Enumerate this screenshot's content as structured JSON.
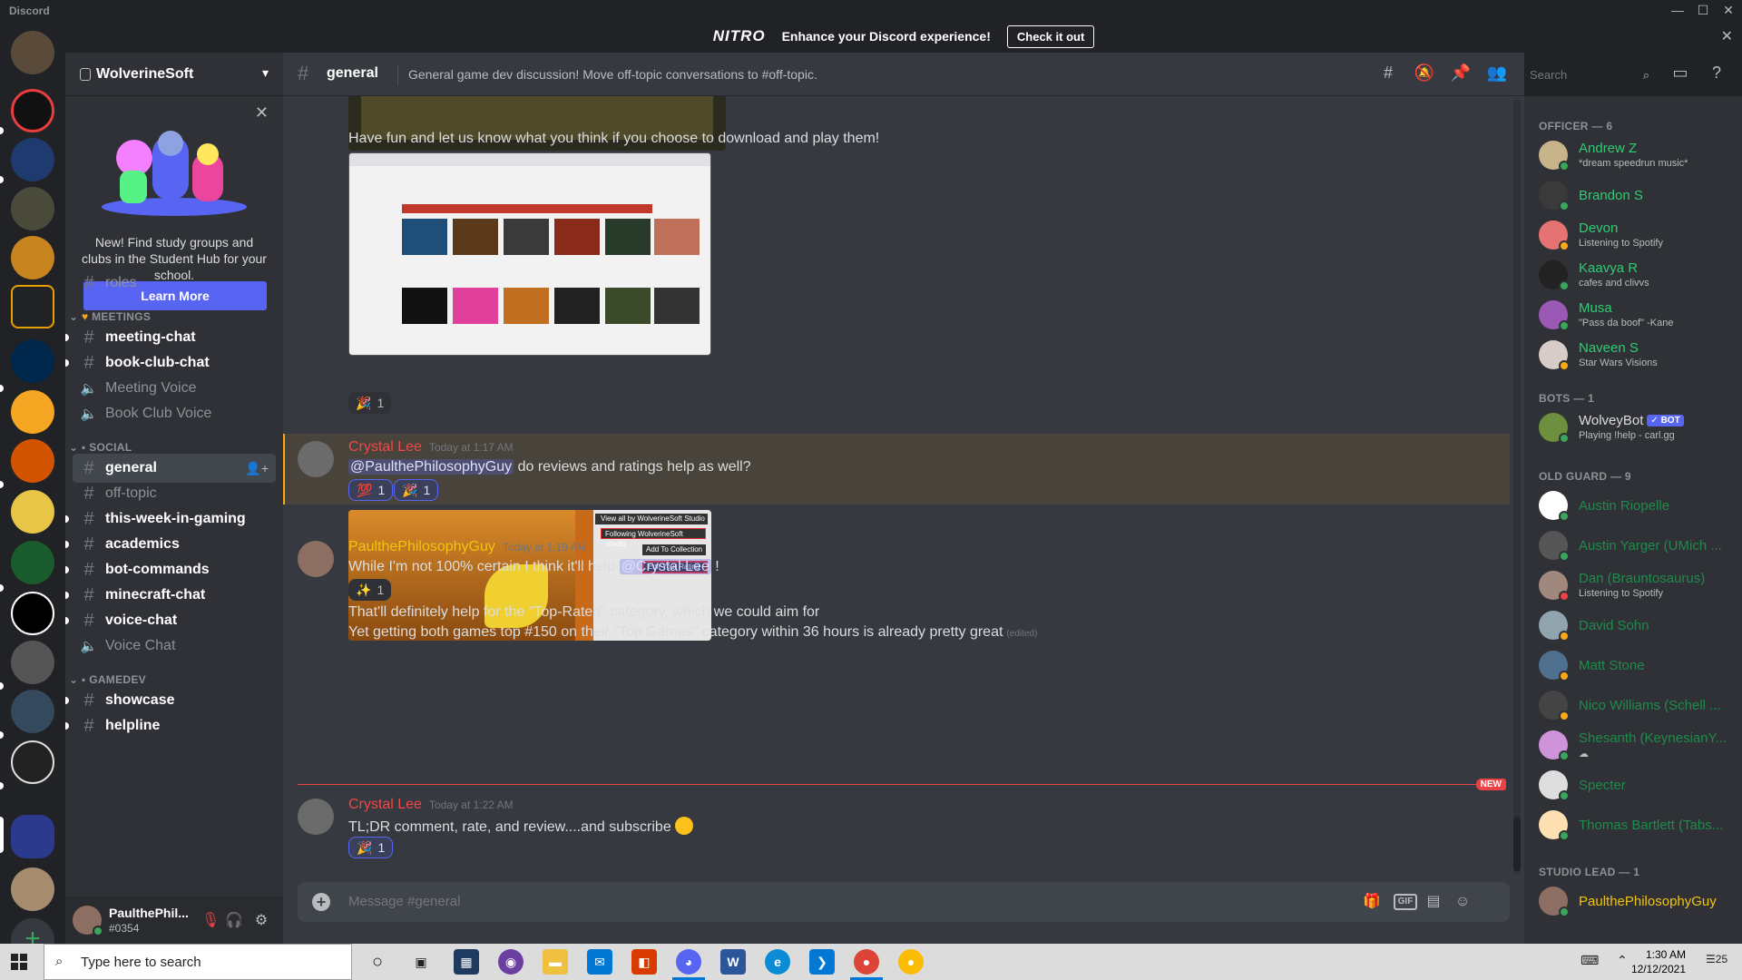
{
  "window": {
    "app_name": "Discord",
    "minimize": "—",
    "maximize": "☐",
    "close": "✕"
  },
  "nitro_banner": {
    "logo": "NITRO",
    "message": "Enhance your Discord experience!",
    "cta": "Check it out",
    "close": "✕"
  },
  "guild": {
    "name": "WolverineSoft"
  },
  "student_hub": {
    "text": "New! Find study groups and clubs in the Student Hub for your school.",
    "button": "Learn More",
    "close": "✕"
  },
  "channels": {
    "roles": "roles",
    "cat_meetings": "MEETINGS",
    "meeting_chat": "meeting-chat",
    "book_club_chat": "book-club-chat",
    "meeting_voice": "Meeting Voice",
    "book_club_voice": "Book Club Voice",
    "cat_social": "SOCIAL",
    "general": "general",
    "off_topic": "off-topic",
    "this_week": "this-week-in-gaming",
    "academics": "academics",
    "bot_commands": "bot-commands",
    "minecraft": "minecraft-chat",
    "voice_chat": "voice-chat",
    "voice_chat_vc": "Voice Chat",
    "cat_gamedev": "GAMEDEV",
    "showcase": "showcase",
    "helpline": "helpline"
  },
  "user_panel": {
    "name": "PaulthePhil...",
    "discriminator": "#0354"
  },
  "header": {
    "channel": "general",
    "topic": "General game dev discussion! Move off-topic conversations to #off-topic.",
    "search_placeholder": "Search"
  },
  "messages": {
    "m0_text": "Have fun and let us know what you think if you choose to download and play them!",
    "m0_react_count": "1",
    "m1_author": "Crystal Lee",
    "m1_time": "Today at 1:17 AM",
    "m1_mention": "@PaulthePhilosophyGuy",
    "m1_text": " do reviews and ratings help as well?",
    "m1_react1_count": "1",
    "m1_react2_count": "1",
    "m1_img_menu": [
      "View all by WolverineSoft Studio",
      "Following WolverineSoft Studio",
      "Add To Collection",
      "Edit Your Rating"
    ],
    "m2_author": "PaulthePhilosophyGuy",
    "m2_time": "Today at 1:19 AM",
    "m2_text": "While I'm not 100% certain I think it'll help ",
    "m2_mention": "@Crystal Lee",
    "m2_text_end": " !",
    "m2_react_count": "1",
    "m2_line2": "That'll definitely help for the \"Top-Rated\" category, which we could aim for",
    "m2_line3": "Yet getting both games top #150 on their \"Top Games\" category within 36 hours is already pretty great",
    "m2_edited": "(edited)",
    "new_tag": "NEW",
    "m3_author": "Crystal Lee",
    "m3_time": "Today at 1:22 AM",
    "m3_text": "TL;DR comment, rate, and review....and subscribe",
    "m3_react_count": "1"
  },
  "composer": {
    "placeholder": "Message #general",
    "gif": "GIF"
  },
  "members": {
    "cat_officer": "OFFICER — 6",
    "andrew": "Andrew Z",
    "andrew_sub": "*dream speedrun music*",
    "brandon": "Brandon S",
    "devon": "Devon",
    "devon_sub": "Listening to Spotify",
    "kaavya": "Kaavya R",
    "kaavya_sub": "cafes and clivvs",
    "musa": "Musa",
    "musa_sub": "\"Pass da boof\" -Kane",
    "naveen": "Naveen S",
    "naveen_sub": "Star Wars Visions",
    "cat_bots": "BOTS — 1",
    "wolvey": "WolveyBot",
    "wolvey_badge": "✓ BOT",
    "wolvey_sub": "Playing !help - carl.gg",
    "cat_old": "OLD GUARD — 9",
    "austin_r": "Austin Riopelle",
    "austin_y": "Austin Yarger (UMich ...",
    "dan": "Dan (Brauntosaurus)",
    "dan_sub": "Listening to Spotify",
    "david": "David Sohn",
    "matt": "Matt Stone",
    "nico": "Nico Williams (Schell ...",
    "shesanth": "Shesanth (KeynesianY...",
    "specter": "Specter",
    "thomas": "Thomas Bartlett (Tabs...",
    "cat_lead": "STUDIO LEAD — 1",
    "paul": "PaulthePhilosophyGuy"
  },
  "taskbar": {
    "search_placeholder": "Type here to search",
    "time": "1:30 AM",
    "date": "12/12/2021",
    "notif": "25"
  }
}
